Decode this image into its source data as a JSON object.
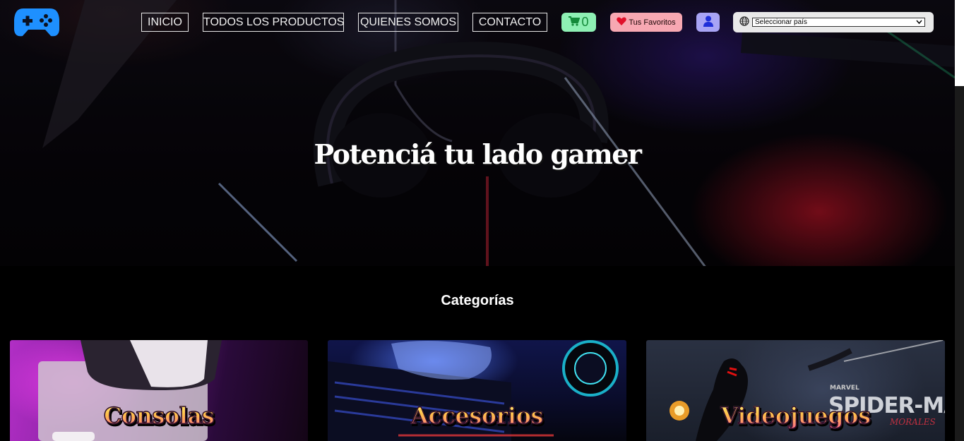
{
  "nav": {
    "links": [
      "INICIO",
      "TODOS LOS PRODUCTOS",
      "QUIENES SOMOS",
      "CONTACTO"
    ],
    "cart_count": "0",
    "favorites_label": "Tus Favoritos",
    "country_select_value": "Seleccionar país"
  },
  "hero": {
    "title": "Potenciá tu lado gamer"
  },
  "categories": {
    "heading": "Categorías",
    "items": [
      {
        "label": "Consolas"
      },
      {
        "label": "Accesorios"
      },
      {
        "label": "Videojuegos"
      }
    ]
  },
  "colors": {
    "logo": "#1e90ff",
    "cart_bg": "#8ef0b4",
    "favorites_bg": "#f7a8b2",
    "user_bg": "#a8a4f5",
    "heart": "#e0102a"
  },
  "icons": [
    "gamepad-icon",
    "cart-icon",
    "heart-icon",
    "user-icon",
    "globe-icon",
    "chevron-down-icon"
  ]
}
